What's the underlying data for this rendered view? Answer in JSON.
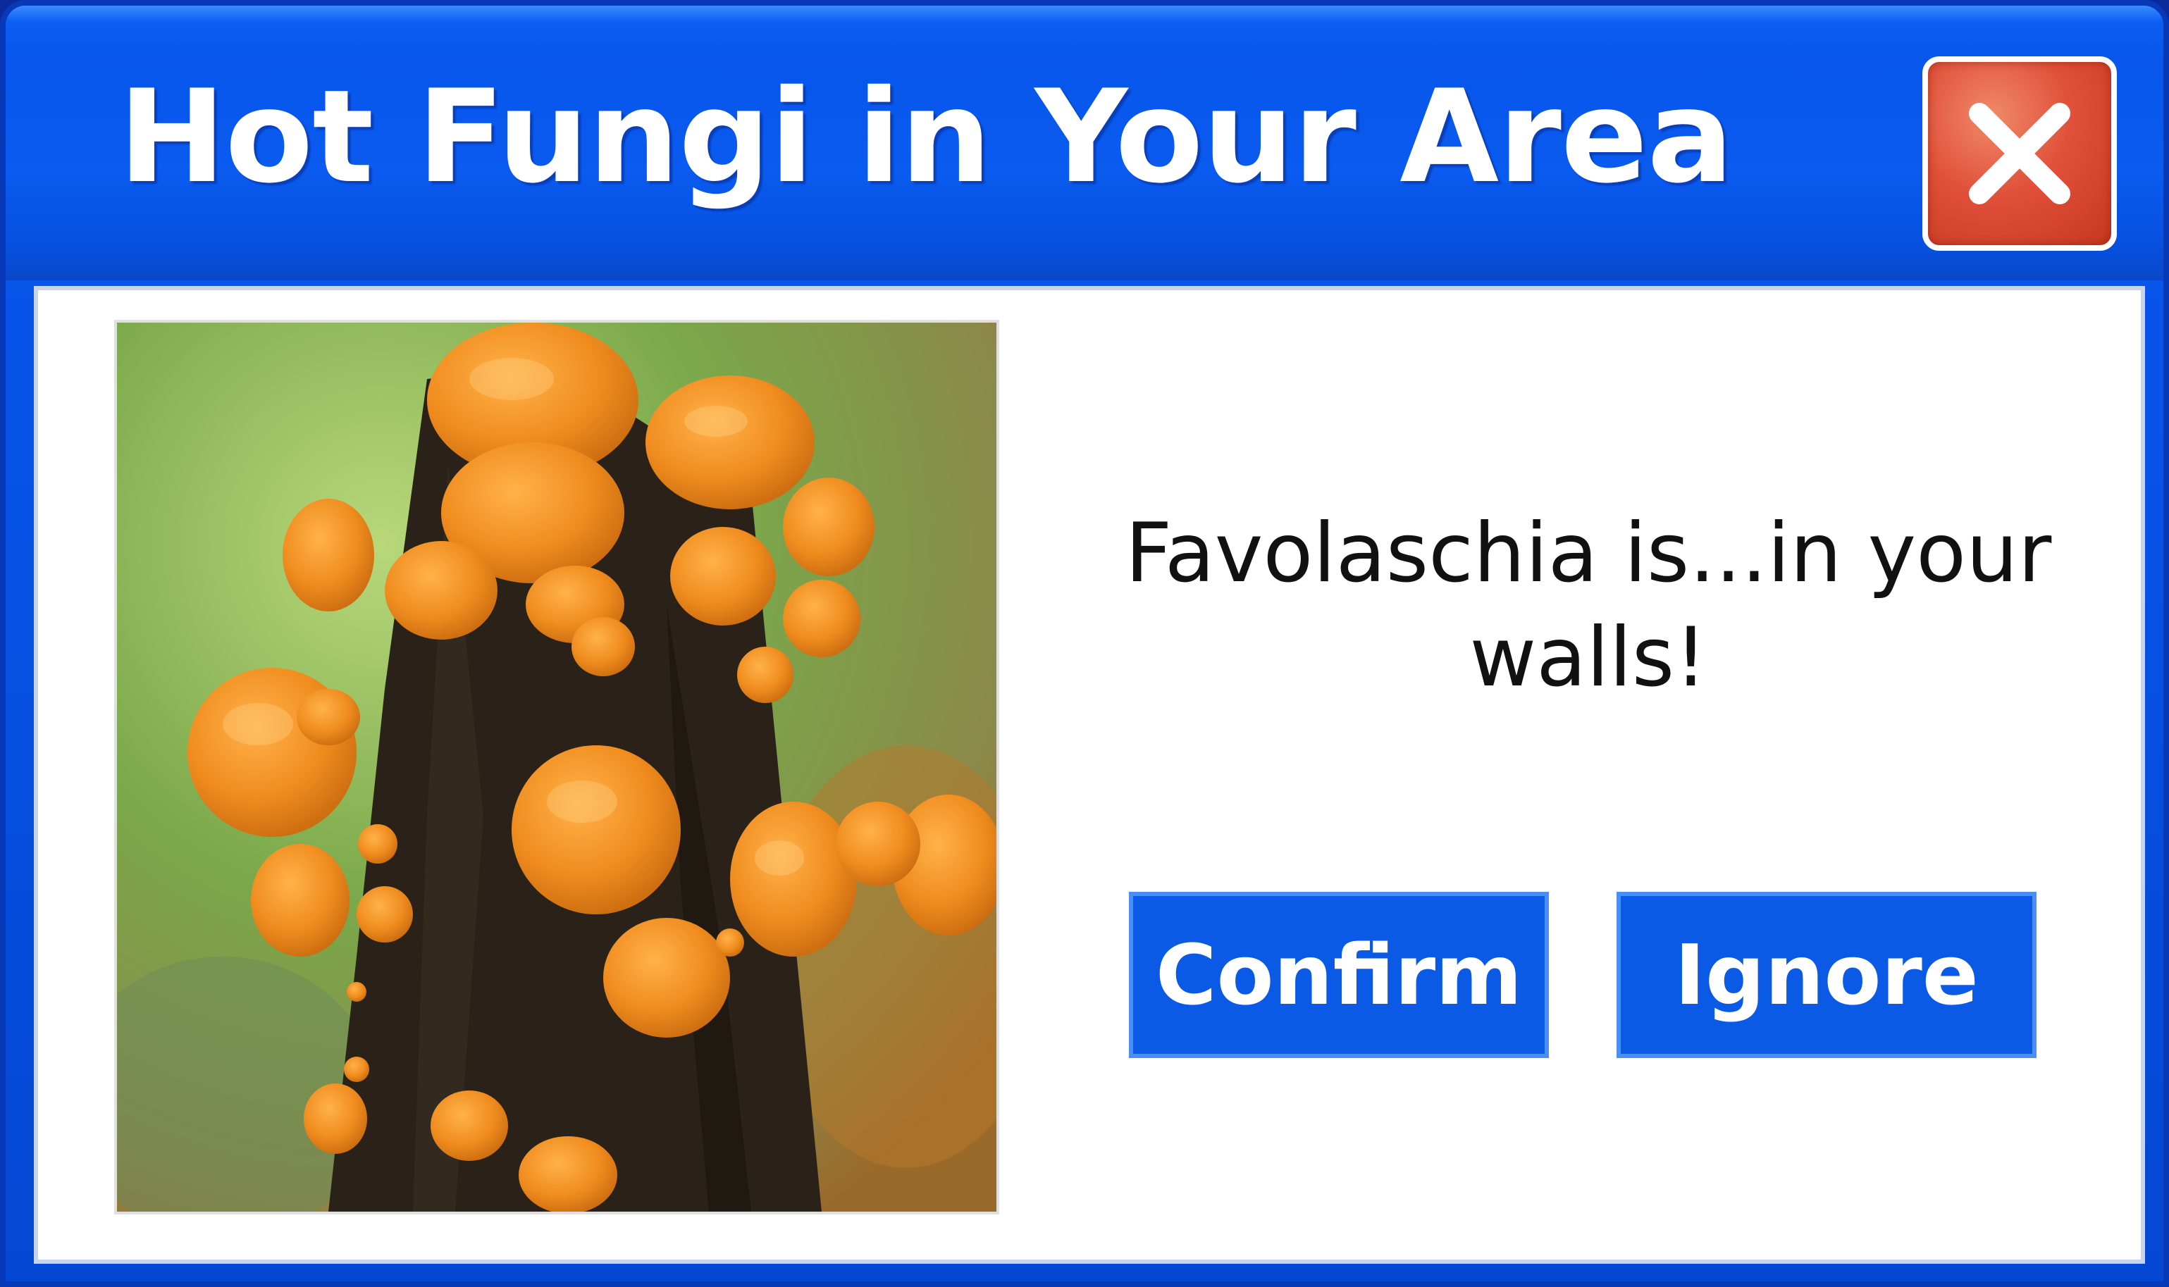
{
  "window": {
    "title": "Hot Fungi in Your Area"
  },
  "dialog": {
    "message": "Favolaschia is...in your walls!",
    "confirm_label": "Confirm",
    "ignore_label": "Ignore"
  },
  "colors": {
    "titlebar": "#0a5bf0",
    "button": "#0a5ae6",
    "close": "#e0503a",
    "fungus": "#f08c1e"
  },
  "icons": {
    "close": "close-icon"
  }
}
